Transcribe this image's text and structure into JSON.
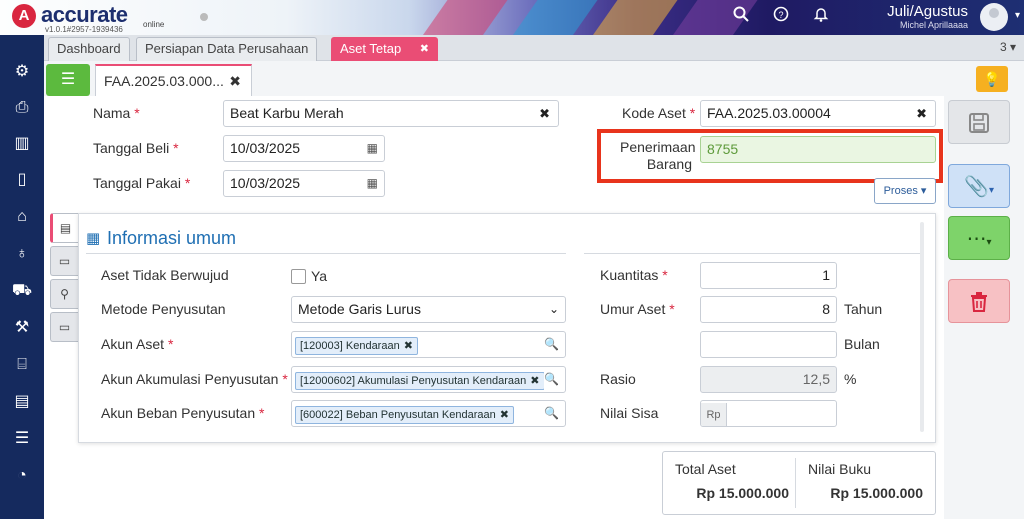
{
  "app": {
    "logo_letter": "A",
    "name": "accurate",
    "sub": "online",
    "version": "v1.0.1#2957-1939436",
    "period": "Juli/Agustus",
    "user": "Michel Aprillaaaa"
  },
  "header_icons": [
    "search-icon",
    "help-icon",
    "bell-icon"
  ],
  "sidebar": [
    "gear-icon",
    "printer-icon",
    "building-icon",
    "book-icon",
    "bank-icon",
    "money-bag-icon",
    "cart-icon",
    "forklift-icon",
    "factory-icon",
    "conveyor-icon",
    "tax-icon",
    "report-icon"
  ],
  "tabs": [
    {
      "label": "Dashboard"
    },
    {
      "label": "Persiapan Data Perusahaan"
    },
    {
      "label": "Aset Tetap",
      "close": "✖"
    }
  ],
  "tab_count": "3",
  "doc_tab": {
    "label": "FAA.2025.03.000...",
    "close": "✖"
  },
  "form": {
    "nama_label": "Nama",
    "nama_value": "Beat Karbu Merah",
    "tgl_beli_label": "Tanggal Beli",
    "tgl_beli_value": "10/03/2025",
    "tgl_pakai_label": "Tanggal Pakai",
    "tgl_pakai_value": "10/03/2025",
    "kode_label": "Kode Aset",
    "kode_value": "FAA.2025.03.00004",
    "penerimaan_label_1": "Penerimaan",
    "penerimaan_label_2": "Barang",
    "penerimaan_value": "8755",
    "proses": "Proses",
    "required": "*"
  },
  "panel": {
    "title": "Informasi umum",
    "aset_tidak_berwujud": "Aset Tidak Berwujud",
    "ya": "Ya",
    "metode_label": "Metode Penyusutan",
    "metode_value": "Metode Garis Lurus",
    "akun_aset_label": "Akun Aset",
    "akun_aset_value": "[120003] Kendaraan",
    "akun_akum_label": "Akun Akumulasi Penyusutan",
    "akun_akum_value": "[12000602] Akumulasi Penyusutan Kendaraan",
    "akun_beban_label": "Akun Beban Penyusutan",
    "akun_beban_value": "[600022] Beban Penyusutan Kendaraan",
    "kuantitas_label": "Kuantitas",
    "kuantitas_value": "1",
    "umur_label": "Umur Aset",
    "umur_value": "8",
    "tahun": "Tahun",
    "bulan_value": "",
    "bulan": "Bulan",
    "rasio_label": "Rasio",
    "rasio_value": "12,5",
    "pct": "%",
    "nilai_sisa_label": "Nilai Sisa",
    "rp": "Rp",
    "nilai_sisa_value": ""
  },
  "totals": {
    "total_aset_label": "Total Aset",
    "total_aset_value": "Rp 15.000.000",
    "nilai_buku_label": "Nilai Buku",
    "nilai_buku_value": "Rp 15.000.000"
  },
  "colors": {
    "accent": "#ea4d75",
    "sidebar": "#152a5e",
    "highlight": "#e8341c"
  }
}
